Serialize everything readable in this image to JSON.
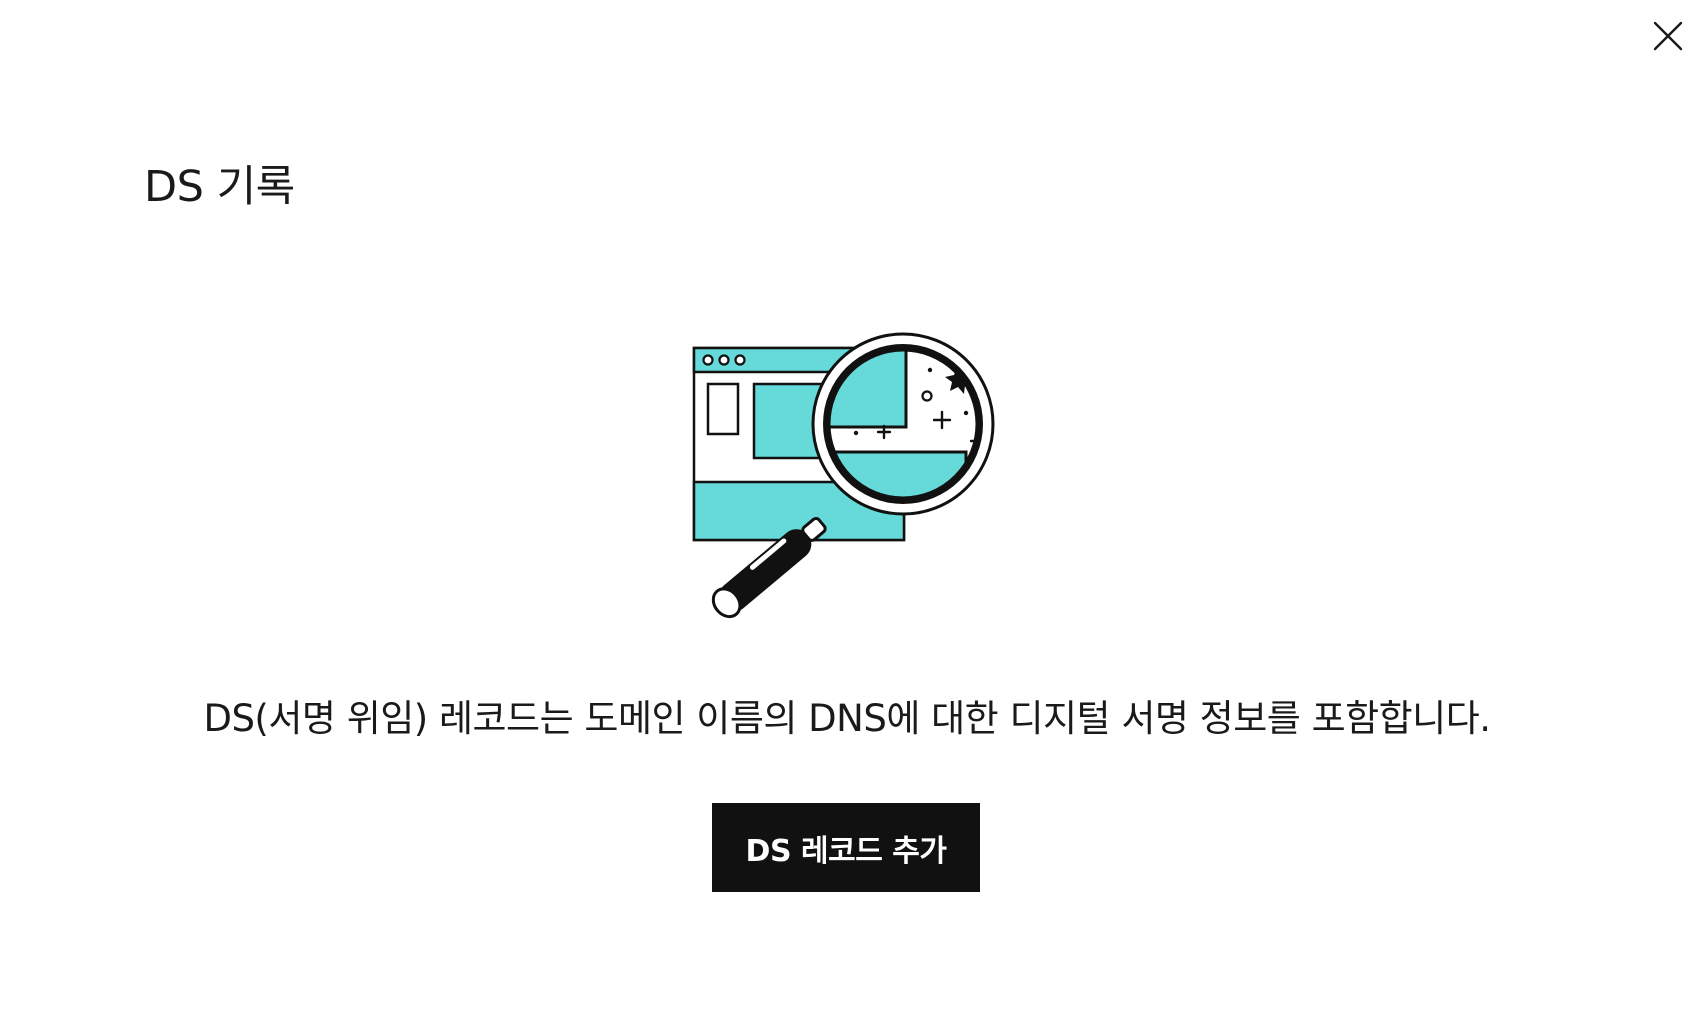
{
  "dialog": {
    "close_icon": "close-icon",
    "title": "DS 기록",
    "illustration_icon": "magnifying-glass-over-browser-illustration",
    "description": "DS(서명 위임) 레코드는 도메인 이름의 DNS에 대한 디지털 서명 정보를 포함합니다.",
    "primary_button_label": "DS 레코드 추가"
  },
  "colors": {
    "accent_teal": "#66d9d9",
    "button_bg": "#111111",
    "button_text": "#ffffff",
    "text": "#1a1a1a"
  }
}
